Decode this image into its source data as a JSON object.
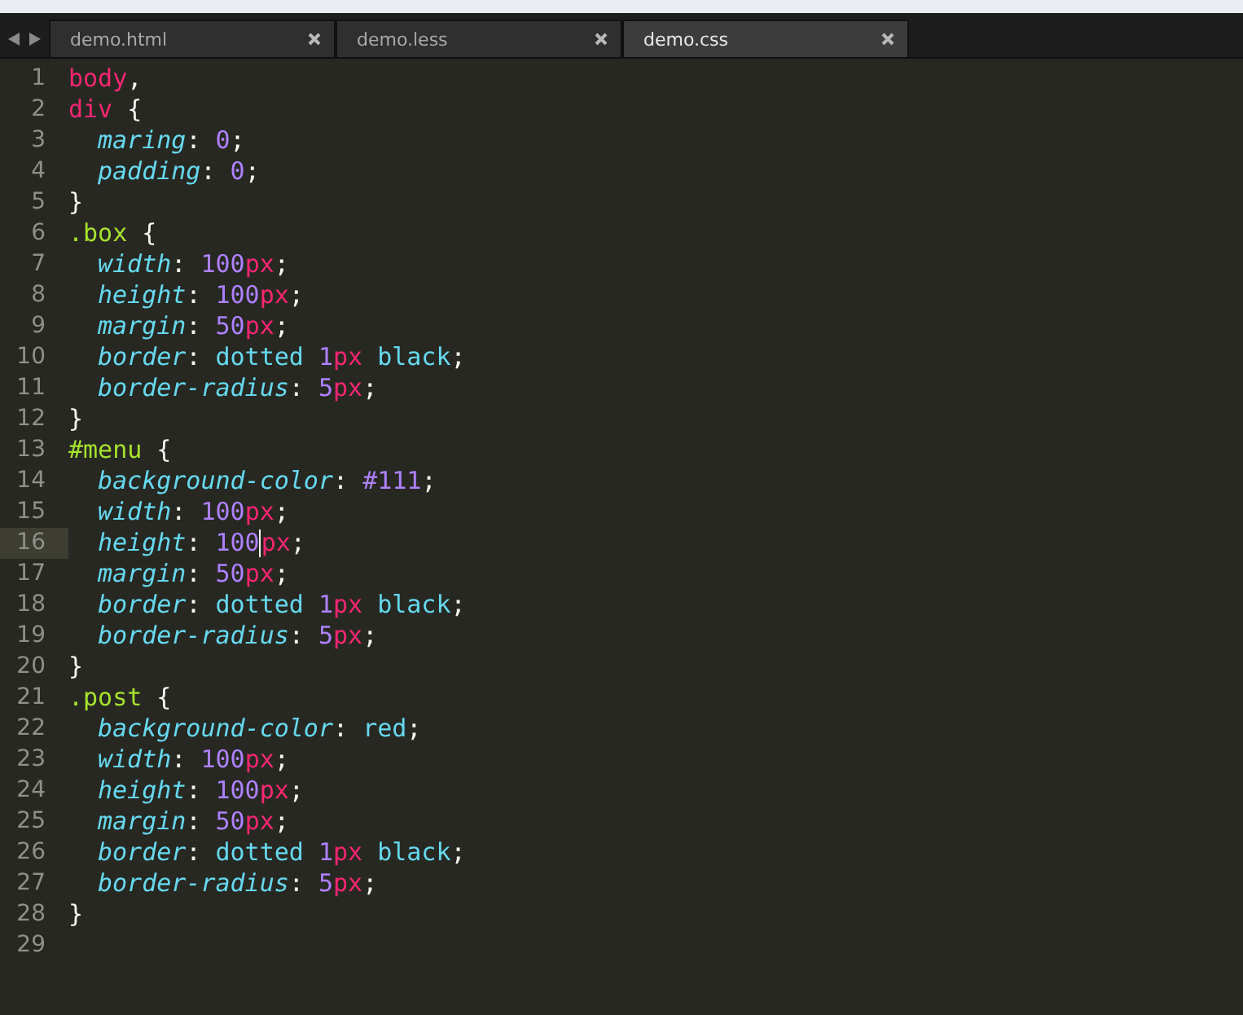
{
  "tabs": [
    {
      "label": "demo.html",
      "selected": false
    },
    {
      "label": "demo.less",
      "selected": false
    },
    {
      "label": "demo.css",
      "selected": true
    }
  ],
  "lines": [
    {
      "number": "1",
      "current": false,
      "indent": false,
      "tokens": [
        {
          "kind": "tag",
          "text": "body"
        },
        {
          "kind": "punct",
          "text": ","
        }
      ]
    },
    {
      "number": "2",
      "current": false,
      "indent": false,
      "tokens": [
        {
          "kind": "tag",
          "text": "div"
        },
        {
          "kind": "punct",
          "text": " {"
        }
      ]
    },
    {
      "number": "3",
      "current": false,
      "indent": true,
      "tokens": [
        {
          "kind": "property",
          "text": "maring"
        },
        {
          "kind": "punct",
          "text": ": "
        },
        {
          "kind": "number",
          "text": "0"
        },
        {
          "kind": "punct",
          "text": ";"
        }
      ]
    },
    {
      "number": "4",
      "current": false,
      "indent": true,
      "tokens": [
        {
          "kind": "property",
          "text": "padding"
        },
        {
          "kind": "punct",
          "text": ": "
        },
        {
          "kind": "number",
          "text": "0"
        },
        {
          "kind": "punct",
          "text": ";"
        }
      ]
    },
    {
      "number": "5",
      "current": false,
      "indent": false,
      "tokens": [
        {
          "kind": "punct",
          "text": "}"
        }
      ]
    },
    {
      "number": "6",
      "current": false,
      "indent": false,
      "tokens": [
        {
          "kind": "selector",
          "text": ".box"
        },
        {
          "kind": "punct",
          "text": " {"
        }
      ]
    },
    {
      "number": "7",
      "current": false,
      "indent": true,
      "tokens": [
        {
          "kind": "property",
          "text": "width"
        },
        {
          "kind": "punct",
          "text": ": "
        },
        {
          "kind": "number",
          "text": "100"
        },
        {
          "kind": "unit",
          "text": "px"
        },
        {
          "kind": "punct",
          "text": ";"
        }
      ]
    },
    {
      "number": "8",
      "current": false,
      "indent": true,
      "tokens": [
        {
          "kind": "property",
          "text": "height"
        },
        {
          "kind": "punct",
          "text": ": "
        },
        {
          "kind": "number",
          "text": "100"
        },
        {
          "kind": "unit",
          "text": "px"
        },
        {
          "kind": "punct",
          "text": ";"
        }
      ]
    },
    {
      "number": "9",
      "current": false,
      "indent": true,
      "tokens": [
        {
          "kind": "property",
          "text": "margin"
        },
        {
          "kind": "punct",
          "text": ": "
        },
        {
          "kind": "number",
          "text": "50"
        },
        {
          "kind": "unit",
          "text": "px"
        },
        {
          "kind": "punct",
          "text": ";"
        }
      ]
    },
    {
      "number": "10",
      "current": false,
      "indent": true,
      "tokens": [
        {
          "kind": "property",
          "text": "border"
        },
        {
          "kind": "punct",
          "text": ": "
        },
        {
          "kind": "value",
          "text": "dotted"
        },
        {
          "kind": "number",
          "text": " 1"
        },
        {
          "kind": "unit",
          "text": "px"
        },
        {
          "kind": "value",
          "text": " black"
        },
        {
          "kind": "punct",
          "text": ";"
        }
      ]
    },
    {
      "number": "11",
      "current": false,
      "indent": true,
      "tokens": [
        {
          "kind": "property",
          "text": "border-radius"
        },
        {
          "kind": "punct",
          "text": ": "
        },
        {
          "kind": "number",
          "text": "5"
        },
        {
          "kind": "unit",
          "text": "px"
        },
        {
          "kind": "punct",
          "text": ";"
        }
      ]
    },
    {
      "number": "12",
      "current": false,
      "indent": false,
      "tokens": [
        {
          "kind": "punct",
          "text": "}"
        }
      ]
    },
    {
      "number": "13",
      "current": false,
      "indent": false,
      "tokens": [
        {
          "kind": "selector",
          "text": "#menu"
        },
        {
          "kind": "punct",
          "text": " {"
        }
      ]
    },
    {
      "number": "14",
      "current": false,
      "indent": true,
      "tokens": [
        {
          "kind": "property",
          "text": "background-color"
        },
        {
          "kind": "punct",
          "text": ": "
        },
        {
          "kind": "number",
          "text": "#111"
        },
        {
          "kind": "punct",
          "text": ";"
        }
      ]
    },
    {
      "number": "15",
      "current": false,
      "indent": true,
      "tokens": [
        {
          "kind": "property",
          "text": "width"
        },
        {
          "kind": "punct",
          "text": ": "
        },
        {
          "kind": "number",
          "text": "100"
        },
        {
          "kind": "unit",
          "text": "px"
        },
        {
          "kind": "punct",
          "text": ";"
        }
      ]
    },
    {
      "number": "16",
      "current": true,
      "indent": true,
      "tokens": [
        {
          "kind": "property",
          "text": "height"
        },
        {
          "kind": "punct",
          "text": ": "
        },
        {
          "kind": "number",
          "text": "100"
        },
        {
          "kind": "caret"
        },
        {
          "kind": "unit",
          "text": "px"
        },
        {
          "kind": "punct",
          "text": ";"
        }
      ]
    },
    {
      "number": "17",
      "current": false,
      "indent": true,
      "tokens": [
        {
          "kind": "property",
          "text": "margin"
        },
        {
          "kind": "punct",
          "text": ": "
        },
        {
          "kind": "number",
          "text": "50"
        },
        {
          "kind": "unit",
          "text": "px"
        },
        {
          "kind": "punct",
          "text": ";"
        }
      ]
    },
    {
      "number": "18",
      "current": false,
      "indent": true,
      "tokens": [
        {
          "kind": "property",
          "text": "border"
        },
        {
          "kind": "punct",
          "text": ": "
        },
        {
          "kind": "value",
          "text": "dotted"
        },
        {
          "kind": "number",
          "text": " 1"
        },
        {
          "kind": "unit",
          "text": "px"
        },
        {
          "kind": "value",
          "text": " black"
        },
        {
          "kind": "punct",
          "text": ";"
        }
      ]
    },
    {
      "number": "19",
      "current": false,
      "indent": true,
      "tokens": [
        {
          "kind": "property",
          "text": "border-radius"
        },
        {
          "kind": "punct",
          "text": ": "
        },
        {
          "kind": "number",
          "text": "5"
        },
        {
          "kind": "unit",
          "text": "px"
        },
        {
          "kind": "punct",
          "text": ";"
        }
      ]
    },
    {
      "number": "20",
      "current": false,
      "indent": false,
      "tokens": [
        {
          "kind": "punct",
          "text": "}"
        }
      ]
    },
    {
      "number": "21",
      "current": false,
      "indent": false,
      "tokens": [
        {
          "kind": "selector",
          "text": ".post"
        },
        {
          "kind": "punct",
          "text": " {"
        }
      ]
    },
    {
      "number": "22",
      "current": false,
      "indent": true,
      "tokens": [
        {
          "kind": "property",
          "text": "background-color"
        },
        {
          "kind": "punct",
          "text": ": "
        },
        {
          "kind": "value",
          "text": "red"
        },
        {
          "kind": "punct",
          "text": ";"
        }
      ]
    },
    {
      "number": "23",
      "current": false,
      "indent": true,
      "tokens": [
        {
          "kind": "property",
          "text": "width"
        },
        {
          "kind": "punct",
          "text": ": "
        },
        {
          "kind": "number",
          "text": "100"
        },
        {
          "kind": "unit",
          "text": "px"
        },
        {
          "kind": "punct",
          "text": ";"
        }
      ]
    },
    {
      "number": "24",
      "current": false,
      "indent": true,
      "tokens": [
        {
          "kind": "property",
          "text": "height"
        },
        {
          "kind": "punct",
          "text": ": "
        },
        {
          "kind": "number",
          "text": "100"
        },
        {
          "kind": "unit",
          "text": "px"
        },
        {
          "kind": "punct",
          "text": ";"
        }
      ]
    },
    {
      "number": "25",
      "current": false,
      "indent": true,
      "tokens": [
        {
          "kind": "property",
          "text": "margin"
        },
        {
          "kind": "punct",
          "text": ": "
        },
        {
          "kind": "number",
          "text": "50"
        },
        {
          "kind": "unit",
          "text": "px"
        },
        {
          "kind": "punct",
          "text": ";"
        }
      ]
    },
    {
      "number": "26",
      "current": false,
      "indent": true,
      "tokens": [
        {
          "kind": "property",
          "text": "border"
        },
        {
          "kind": "punct",
          "text": ": "
        },
        {
          "kind": "value",
          "text": "dotted"
        },
        {
          "kind": "number",
          "text": " 1"
        },
        {
          "kind": "unit",
          "text": "px"
        },
        {
          "kind": "value",
          "text": " black"
        },
        {
          "kind": "punct",
          "text": ";"
        }
      ]
    },
    {
      "number": "27",
      "current": false,
      "indent": true,
      "tokens": [
        {
          "kind": "property",
          "text": "border-radius"
        },
        {
          "kind": "punct",
          "text": ": "
        },
        {
          "kind": "number",
          "text": "5"
        },
        {
          "kind": "unit",
          "text": "px"
        },
        {
          "kind": "punct",
          "text": ";"
        }
      ]
    },
    {
      "number": "28",
      "current": false,
      "indent": false,
      "tokens": [
        {
          "kind": "punct",
          "text": "}"
        }
      ]
    },
    {
      "number": "29",
      "current": false
    }
  ]
}
